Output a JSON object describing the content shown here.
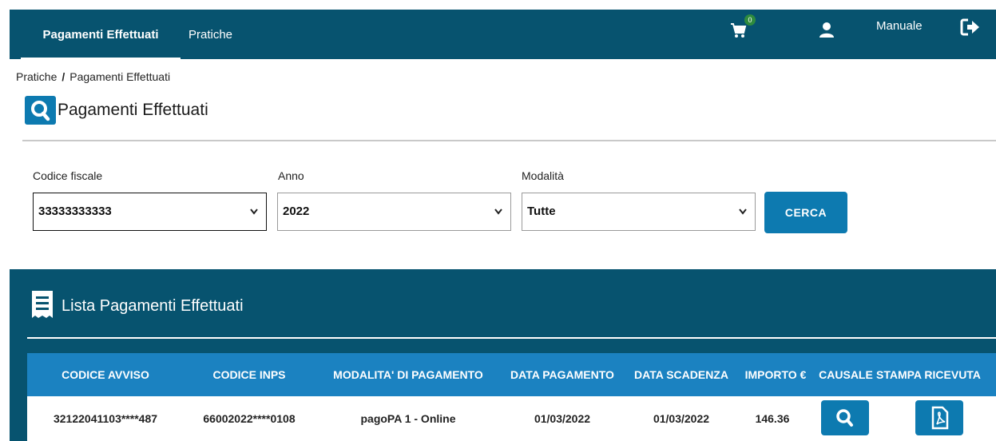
{
  "nav": {
    "tabs": [
      {
        "label": "Pagamenti Effettuati",
        "active": true
      },
      {
        "label": "Pratiche",
        "active": false
      }
    ],
    "cart_count": "0",
    "manuale_label": "Manuale",
    "icons": [
      "cart-icon",
      "user-icon",
      "logout-icon"
    ]
  },
  "breadcrumb": {
    "items": [
      "Pratiche",
      "Pagamenti Effettuati"
    ],
    "separator": "/"
  },
  "page": {
    "title": "Pagamenti Effettuati"
  },
  "filters": {
    "codice_fiscale": {
      "label": "Codice fiscale",
      "value": "33333333333"
    },
    "anno": {
      "label": "Anno",
      "value": "2022"
    },
    "modalita": {
      "label": "Modalità",
      "value": "Tutte"
    },
    "search_button": "CERCA"
  },
  "list": {
    "title": "Lista Pagamenti Effettuati",
    "columns": [
      "CODICE AVVISO",
      "CODICE INPS",
      "MODALITA' DI PAGAMENTO",
      "DATA PAGAMENTO",
      "DATA SCADENZA",
      "IMPORTO €",
      "CAUSALE",
      "STAMPA RICEVUTA"
    ],
    "rows": [
      [
        "32122041103****487",
        "66002022****0108",
        "pagoPA 1 - Online",
        "01/03/2022",
        "01/03/2022",
        "146.36"
      ]
    ]
  },
  "colors": {
    "nav_bg": "#07536f",
    "accent": "#0d7ab0",
    "header_bg": "#1b82c1"
  }
}
